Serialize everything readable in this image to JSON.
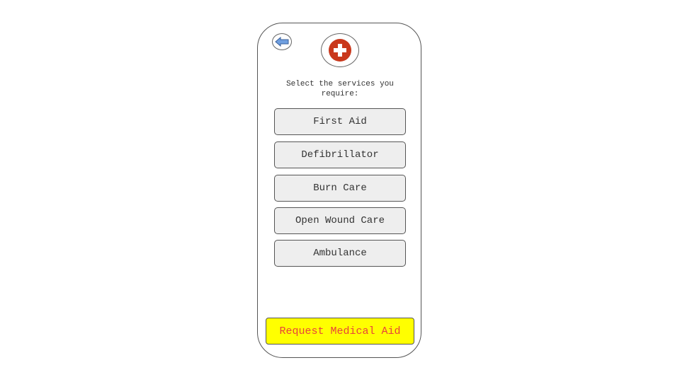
{
  "icons": {
    "back": "arrow-left-icon",
    "logo": "medical-cross-icon"
  },
  "colors": {
    "back_arrow": "#6f9fe0",
    "logo_red": "#c9381c",
    "request_bg": "#ffff00",
    "request_text": "#e8433a",
    "service_bg": "#eeeeee"
  },
  "prompt": "Select the services you require:",
  "services": [
    {
      "label": "First Aid"
    },
    {
      "label": "Defibrillator"
    },
    {
      "label": "Burn Care"
    },
    {
      "label": "Open Wound Care"
    },
    {
      "label": "Ambulance"
    }
  ],
  "request_label": "Request Medical Aid"
}
